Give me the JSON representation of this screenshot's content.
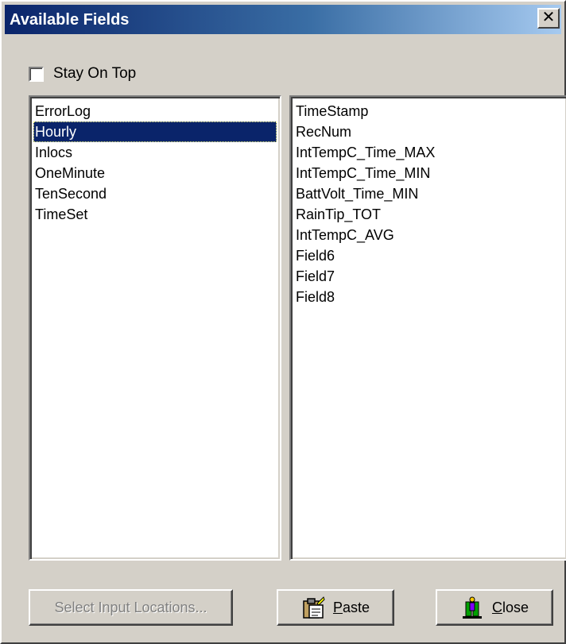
{
  "window": {
    "title": "Available Fields",
    "close_glyph": "✕"
  },
  "options": {
    "stay_on_top_label": "Stay On Top",
    "stay_on_top_checked": false
  },
  "tables_list": {
    "items": [
      "ErrorLog",
      "Hourly",
      "Inlocs",
      "OneMinute",
      "TenSecond",
      "TimeSet"
    ],
    "selected": "Hourly"
  },
  "fields_list": {
    "items": [
      "TimeStamp",
      "RecNum",
      "IntTempC_Time_MAX",
      "IntTempC_Time_MIN",
      "BattVolt_Time_MIN",
      "RainTip_TOT",
      "IntTempC_AVG",
      "Field6",
      "Field7",
      "Field8"
    ]
  },
  "buttons": {
    "select_input_locations": "Select Input Locations...",
    "paste_first": "P",
    "paste_rest": "aste",
    "close_first": "C",
    "close_rest": "lose"
  },
  "icons": {
    "paste": "paste-icon",
    "close": "exit-door-icon"
  },
  "colors": {
    "selection": "#0a246a",
    "titlebar_start": "#0a246a",
    "titlebar_end": "#a6caf0",
    "face": "#d4d0c8"
  }
}
